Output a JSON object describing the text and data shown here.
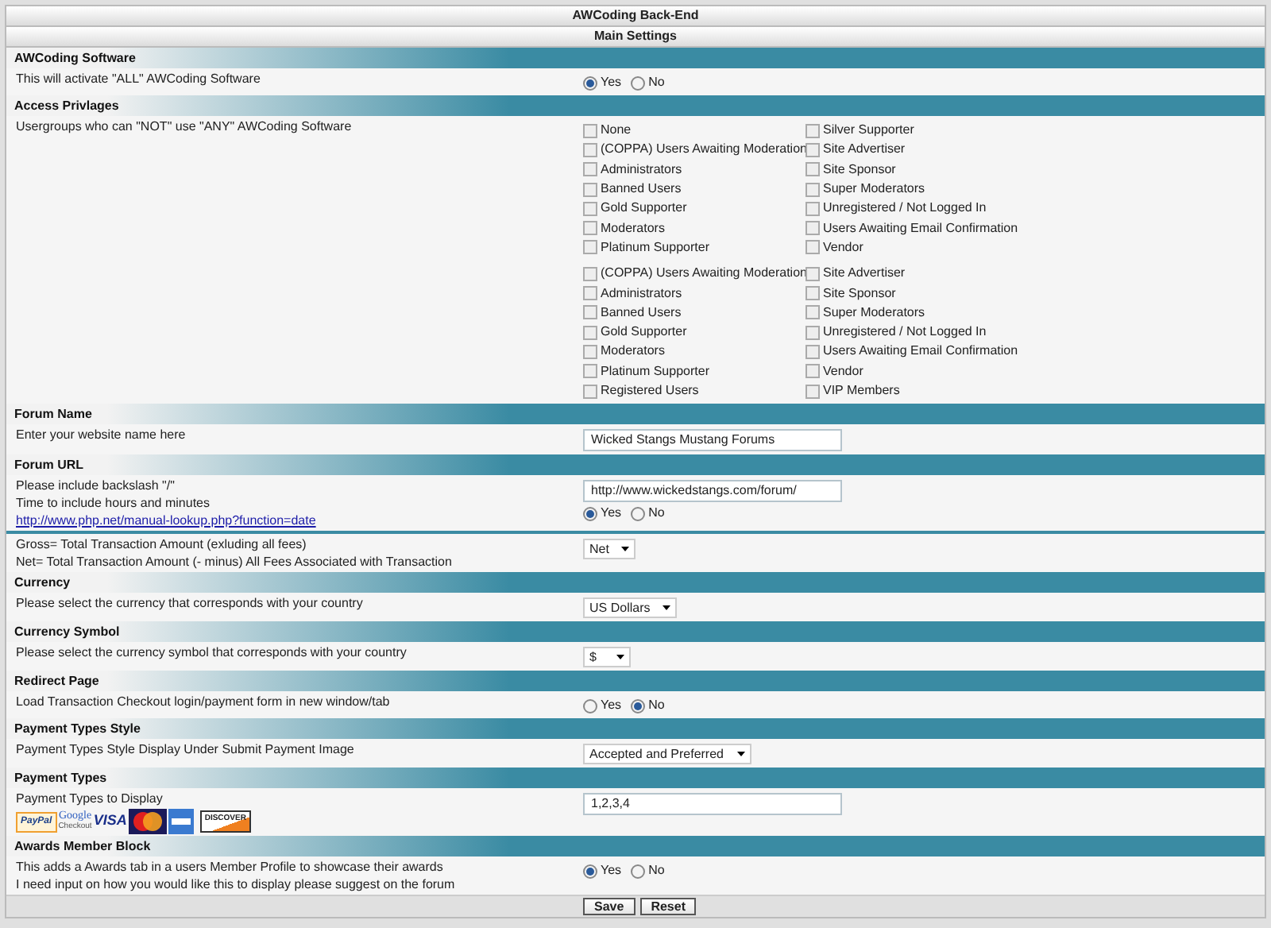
{
  "window": {
    "title": "AWCoding Back-End",
    "subtitle": "Main Settings"
  },
  "sections": [
    {
      "title": "AWCoding Software",
      "rows": [
        {
          "lines": [
            "This will activate \"ALL\" AWCoding Software"
          ],
          "controls": [
            {
              "kind": "radio",
              "options": [
                {
                  "label": "Yes",
                  "selected": true
                },
                {
                  "label": "No",
                  "selected": false
                }
              ]
            }
          ]
        }
      ]
    },
    {
      "title": "Access Privlages",
      "rows": [
        {
          "lines": [
            "Usergroups who can \"NOT\" use \"ANY\" AWCoding Software"
          ],
          "controls": [
            {
              "kind": "checkboxes",
              "groups": [
                {
                  "columns": [
                    [
                      {
                        "label": "None",
                        "checked": false
                      },
                      {
                        "label": "(COPPA) Users Awaiting Moderation",
                        "checked": false
                      },
                      {
                        "label": "Administrators",
                        "checked": false
                      },
                      {
                        "label": "Banned Users",
                        "checked": false
                      },
                      {
                        "label": "Gold Supporter",
                        "checked": false
                      },
                      {
                        "label": "Moderators",
                        "checked": false
                      },
                      {
                        "label": "Platinum Supporter",
                        "checked": false
                      }
                    ],
                    [
                      {
                        "label": "Silver Supporter",
                        "checked": false
                      },
                      {
                        "label": "Site Advertiser",
                        "checked": false
                      },
                      {
                        "label": "Site Sponsor",
                        "checked": false
                      },
                      {
                        "label": "Super Moderators",
                        "checked": false
                      },
                      {
                        "label": "Unregistered / Not Logged In",
                        "checked": false
                      },
                      {
                        "label": "Users Awaiting Email Confirmation",
                        "checked": false
                      },
                      {
                        "label": "Vendor",
                        "checked": false
                      }
                    ]
                  ]
                },
                {
                  "columns": [
                    [
                      {
                        "label": "(COPPA) Users Awaiting Moderation",
                        "checked": false
                      },
                      {
                        "label": "Administrators",
                        "checked": false
                      },
                      {
                        "label": "Banned Users",
                        "checked": false
                      },
                      {
                        "label": "Gold Supporter",
                        "checked": false
                      },
                      {
                        "label": "Moderators",
                        "checked": false
                      },
                      {
                        "label": "Platinum Supporter",
                        "checked": false
                      },
                      {
                        "label": "Registered Users",
                        "checked": false
                      }
                    ],
                    [
                      {
                        "label": "Site Advertiser",
                        "checked": false
                      },
                      {
                        "label": "Site Sponsor",
                        "checked": false
                      },
                      {
                        "label": "Super Moderators",
                        "checked": false
                      },
                      {
                        "label": "Unregistered / Not Logged In",
                        "checked": false
                      },
                      {
                        "label": "Users Awaiting Email Confirmation",
                        "checked": false
                      },
                      {
                        "label": "Vendor",
                        "checked": false
                      },
                      {
                        "label": "VIP Members",
                        "checked": false
                      }
                    ]
                  ]
                }
              ]
            }
          ]
        }
      ]
    },
    {
      "title": "Forum Name",
      "rows": [
        {
          "lines": [
            "Enter your website name here"
          ],
          "controls": [
            {
              "kind": "input",
              "value": "Wicked Stangs Mustang Forums"
            }
          ]
        }
      ]
    },
    {
      "title": "Forum URL",
      "rows": [
        {
          "lines": [
            "Please include backslash \"/\"",
            "Time to include hours and minutes"
          ],
          "link": "http://www.php.net/manual-lookup.php?function=date",
          "controls": [
            {
              "kind": "input",
              "value": "http://www.wickedstangs.com/forum/"
            },
            {
              "kind": "radio",
              "options": [
                {
                  "label": "Yes",
                  "selected": true
                },
                {
                  "label": "No",
                  "selected": false
                }
              ]
            }
          ]
        },
        {
          "lines": [
            "Gross= Total Transaction Amount (exluding all fees)",
            "Net= Total Transaction Amount (- minus) All Fees Associated with Transaction"
          ],
          "controls": [
            {
              "kind": "select",
              "value": "Net"
            }
          ]
        }
      ]
    },
    {
      "title": "Currency",
      "rows": [
        {
          "lines": [
            "Please select the currency that corresponds with your country"
          ],
          "controls": [
            {
              "kind": "select",
              "value": "US Dollars"
            }
          ]
        }
      ]
    },
    {
      "title": "Currency Symbol",
      "rows": [
        {
          "lines": [
            "Please select the currency symbol that corresponds with your country"
          ],
          "controls": [
            {
              "kind": "select",
              "value": "$"
            }
          ]
        }
      ]
    },
    {
      "title": "Redirect Page",
      "rows": [
        {
          "lines": [
            "Load Transaction Checkout login/payment form in new window/tab"
          ],
          "controls": [
            {
              "kind": "radio",
              "options": [
                {
                  "label": "Yes",
                  "selected": false
                },
                {
                  "label": "No",
                  "selected": true
                }
              ]
            }
          ]
        }
      ]
    },
    {
      "title": "Payment Types Style",
      "rows": [
        {
          "lines": [
            "Payment Types Style Display Under Submit Payment Image"
          ],
          "controls": [
            {
              "kind": "select",
              "value": "Accepted and Preferred"
            }
          ]
        }
      ]
    },
    {
      "title": "Payment Types",
      "rows": [
        {
          "lines": [
            "Payment Types to Display"
          ],
          "logos": [
            {
              "kind": "paypal",
              "text": "PayPal"
            },
            {
              "kind": "google",
              "text": "Google",
              "subtext": "Checkout"
            },
            {
              "kind": "visa",
              "text": "VISA"
            },
            {
              "kind": "mastercard"
            },
            {
              "kind": "amex"
            },
            {
              "kind": "discover",
              "text": "DISCOVER"
            }
          ],
          "controls": [
            {
              "kind": "input",
              "value": "1,2,3,4"
            }
          ]
        }
      ]
    },
    {
      "title": "Awards Member Block",
      "rows": [
        {
          "lines": [
            "This adds a Awards tab in a users Member Profile to showcase their awards",
            "I need input on how you would like this to display please suggest on the forum"
          ],
          "controls": [
            {
              "kind": "radio",
              "options": [
                {
                  "label": "Yes",
                  "selected": true
                },
                {
                  "label": "No",
                  "selected": false
                }
              ]
            }
          ]
        }
      ]
    }
  ],
  "buttons": [
    "Save",
    "Reset"
  ]
}
